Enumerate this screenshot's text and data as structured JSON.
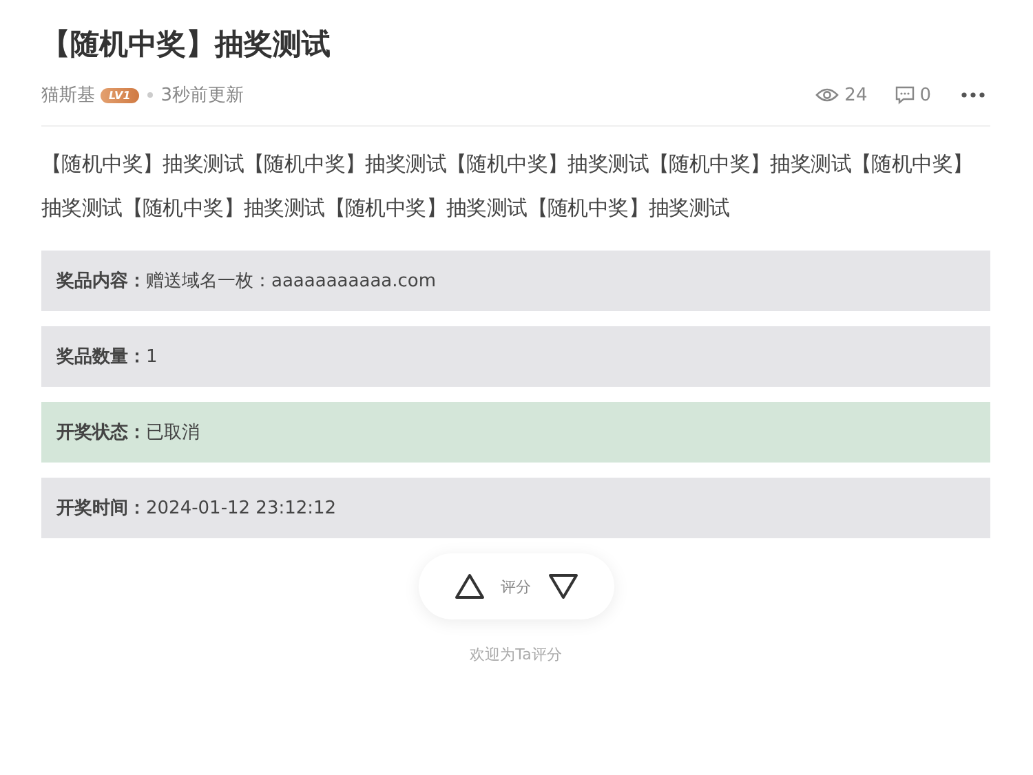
{
  "title": "【随机中奖】抽奖测试",
  "meta": {
    "author": "猫斯基",
    "level_badge": "LV1",
    "updated": "3秒前更新",
    "views": "24",
    "comments": "0"
  },
  "body": "【随机中奖】抽奖测试【随机中奖】抽奖测试【随机中奖】抽奖测试【随机中奖】抽奖测试【随机中奖】抽奖测试【随机中奖】抽奖测试【随机中奖】抽奖测试【随机中奖】抽奖测试",
  "info_rows": [
    {
      "kind": "info",
      "label": "奖品内容：",
      "value": "赠送域名一枚：aaaaaaaaaaa.com"
    },
    {
      "kind": "info",
      "label": "奖品数量：",
      "value": "1"
    },
    {
      "kind": "success",
      "label": "开奖状态：",
      "value": "已取消"
    },
    {
      "kind": "info",
      "label": "开奖时间：",
      "value": "2024-01-12 23:12:12"
    }
  ],
  "rating": {
    "label": "评分",
    "hint": "欢迎为Ta评分"
  }
}
